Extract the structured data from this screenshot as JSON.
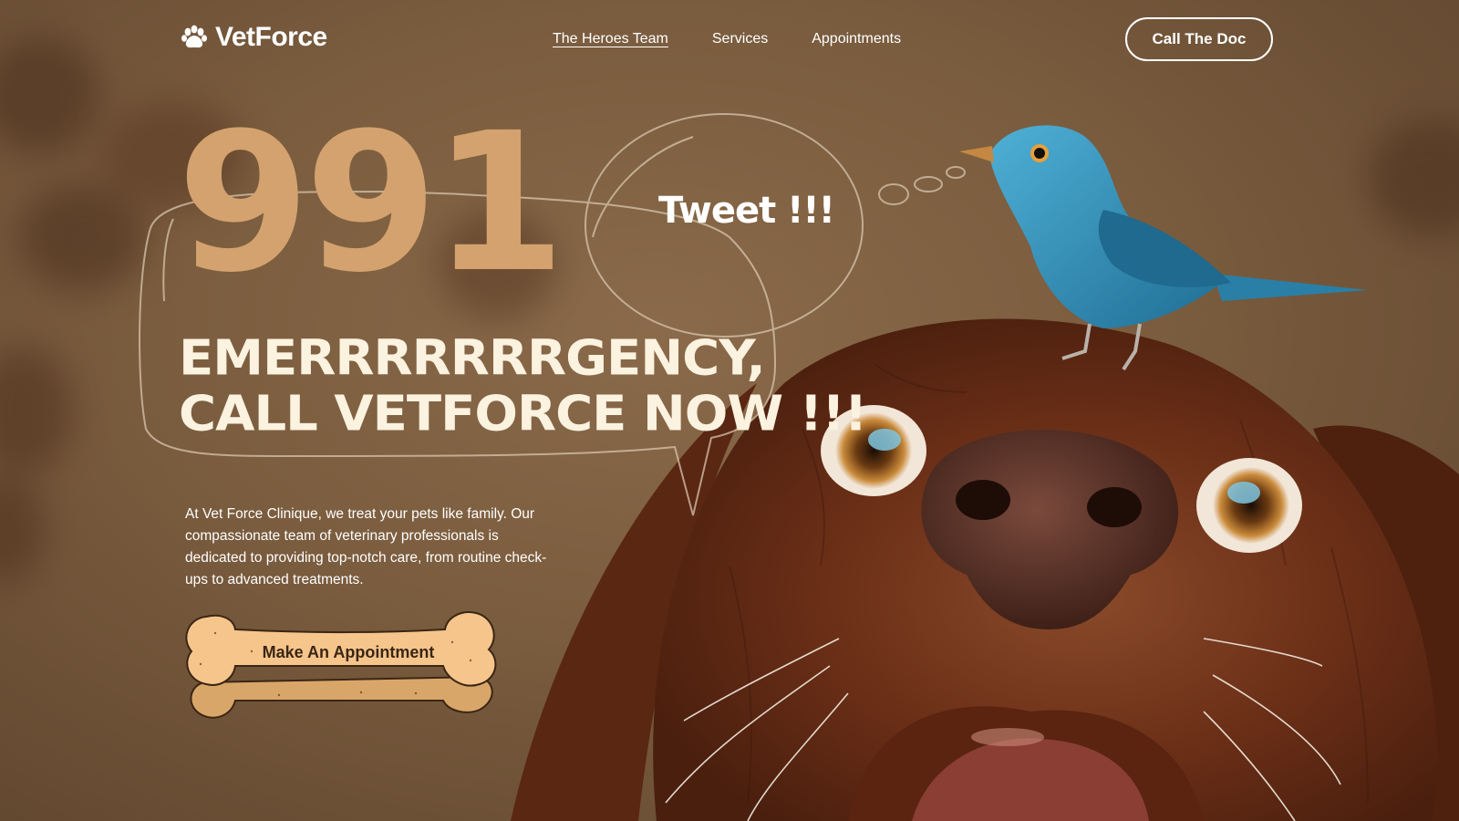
{
  "brand": {
    "name": "VetForce"
  },
  "nav": {
    "items": [
      {
        "label": "The Heroes Team",
        "active": true
      },
      {
        "label": "Services",
        "active": false
      },
      {
        "label": "Appointments",
        "active": false
      }
    ],
    "call_button": "Call The Doc"
  },
  "hero": {
    "number": "991",
    "headline_line1": "EMERRRRRRRGENCY,",
    "headline_line2": "CALL VETFORCE NOW !!!",
    "bubble_text": "Tweet !!!",
    "description": "At Vet Force Clinique, we treat your pets like family. Our compassionate team of veterinary professionals is dedicated to providing top-notch care, from routine check-ups to advanced treatments.",
    "cta_label": "Make An Appointment"
  },
  "colors": {
    "background": "#7a5c3e",
    "number_accent": "#d4a26e",
    "headline": "#fbf2e0",
    "bone": "#f6c58c",
    "bird": "#2e8fb8",
    "dog": "#6b2f17"
  },
  "icons": {
    "logo": "paw-icon"
  }
}
